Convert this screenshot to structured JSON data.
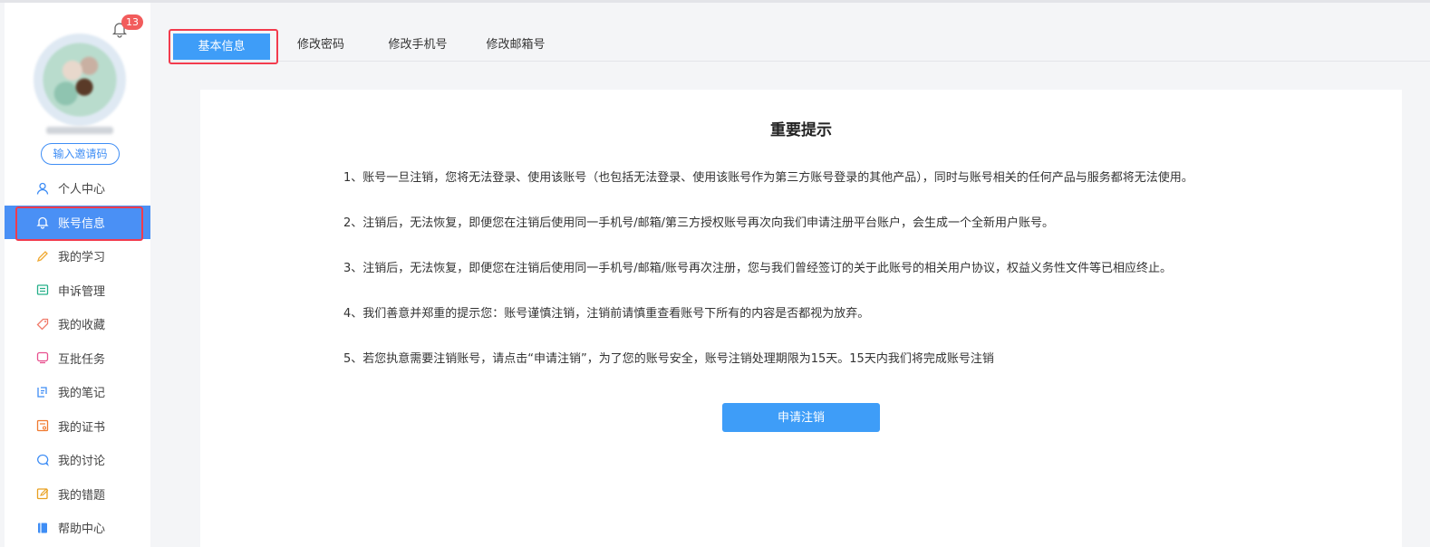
{
  "header": {
    "notification_count": "13"
  },
  "sidebar": {
    "invite_label": "输入邀请码",
    "items": [
      {
        "label": "个人中心",
        "icon": "user-icon"
      },
      {
        "label": "账号信息",
        "icon": "bell-icon",
        "active": true
      },
      {
        "label": "我的学习",
        "icon": "pencil-icon"
      },
      {
        "label": "申诉管理",
        "icon": "list-icon"
      },
      {
        "label": "我的收藏",
        "icon": "tag-icon"
      },
      {
        "label": "互批任务",
        "icon": "chat-box-icon"
      },
      {
        "label": "我的笔记",
        "icon": "note-icon"
      },
      {
        "label": "我的证书",
        "icon": "certificate-icon"
      },
      {
        "label": "我的讨论",
        "icon": "discussion-icon"
      },
      {
        "label": "我的错题",
        "icon": "edit-box-icon"
      },
      {
        "label": "帮助中心",
        "icon": "book-icon"
      }
    ]
  },
  "tabs": [
    {
      "label": "基本信息",
      "active": true
    },
    {
      "label": "修改密码"
    },
    {
      "label": "修改手机号"
    },
    {
      "label": "修改邮箱号"
    }
  ],
  "notice": {
    "title": "重要提示",
    "paragraphs": [
      "1、账号一旦注销，您将无法登录、使用该账号（也包括无法登录、使用该账号作为第三方账号登录的其他产品），同时与账号相关的任何产品与服务都将无法使用。",
      "2、注销后，无法恢复，即便您在注销后使用同一手机号/邮箱/第三方授权账号再次向我们申请注册平台账户，会生成一个全新用户账号。",
      "3、注销后，无法恢复，即便您在注销后使用同一手机号/邮箱/账号再次注册，您与我们曾经签订的关于此账号的相关用户协议，权益义务性文件等已相应终止。",
      "4、我们善意并郑重的提示您：账号谨慎注销，注销前请慎重查看账号下所有的内容是否都视为放弃。",
      "5、若您执意需要注销账号，请点击“申请注销”，为了您的账号安全，账号注销处理期限为15天。15天内我们将完成账号注销"
    ],
    "apply_label": "申请注销"
  },
  "colors": {
    "accent": "#3e9df8",
    "highlight": "#f23b4d",
    "badge": "#f25c5c"
  }
}
